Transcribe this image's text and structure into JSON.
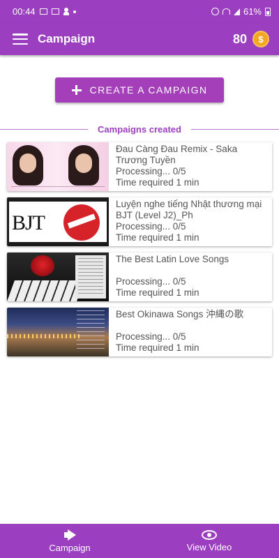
{
  "status_bar": {
    "time": "00:44",
    "battery": "61%"
  },
  "app_bar": {
    "title": "Campaign",
    "coin_count": "80",
    "coin_symbol": "$"
  },
  "actions": {
    "create_label": "CREATE A CAMPAIGN"
  },
  "section": {
    "title": "Campaigns created"
  },
  "campaigns": [
    {
      "title": "Đau Càng Đau Remix - Saka Trương Tuyền",
      "status": "Processing... 0/5",
      "time": "Time required 1 min"
    },
    {
      "title": "Luyện nghe tiếng Nhật thương mại BJT (Level J2)_Ph",
      "status": "Processing... 0/5",
      "time": "Time required 1 min"
    },
    {
      "title": "The Best Latin Love Songs",
      "status": "Processing... 0/5",
      "time": "Time required 1 min"
    },
    {
      "title": "Best Okinawa Songs 沖縄の歌",
      "status": "Processing... 0/5",
      "time": "Time required 1 min"
    }
  ],
  "thumbnail_text": {
    "bjt": "BJT"
  },
  "bottom_nav": [
    {
      "label": "Campaign",
      "icon": "megaphone-icon"
    },
    {
      "label": "View Video",
      "icon": "eye-icon"
    }
  ],
  "colors": {
    "primary": "#9b3fc0",
    "button": "#a43fb9",
    "coin": "#f4a623"
  }
}
